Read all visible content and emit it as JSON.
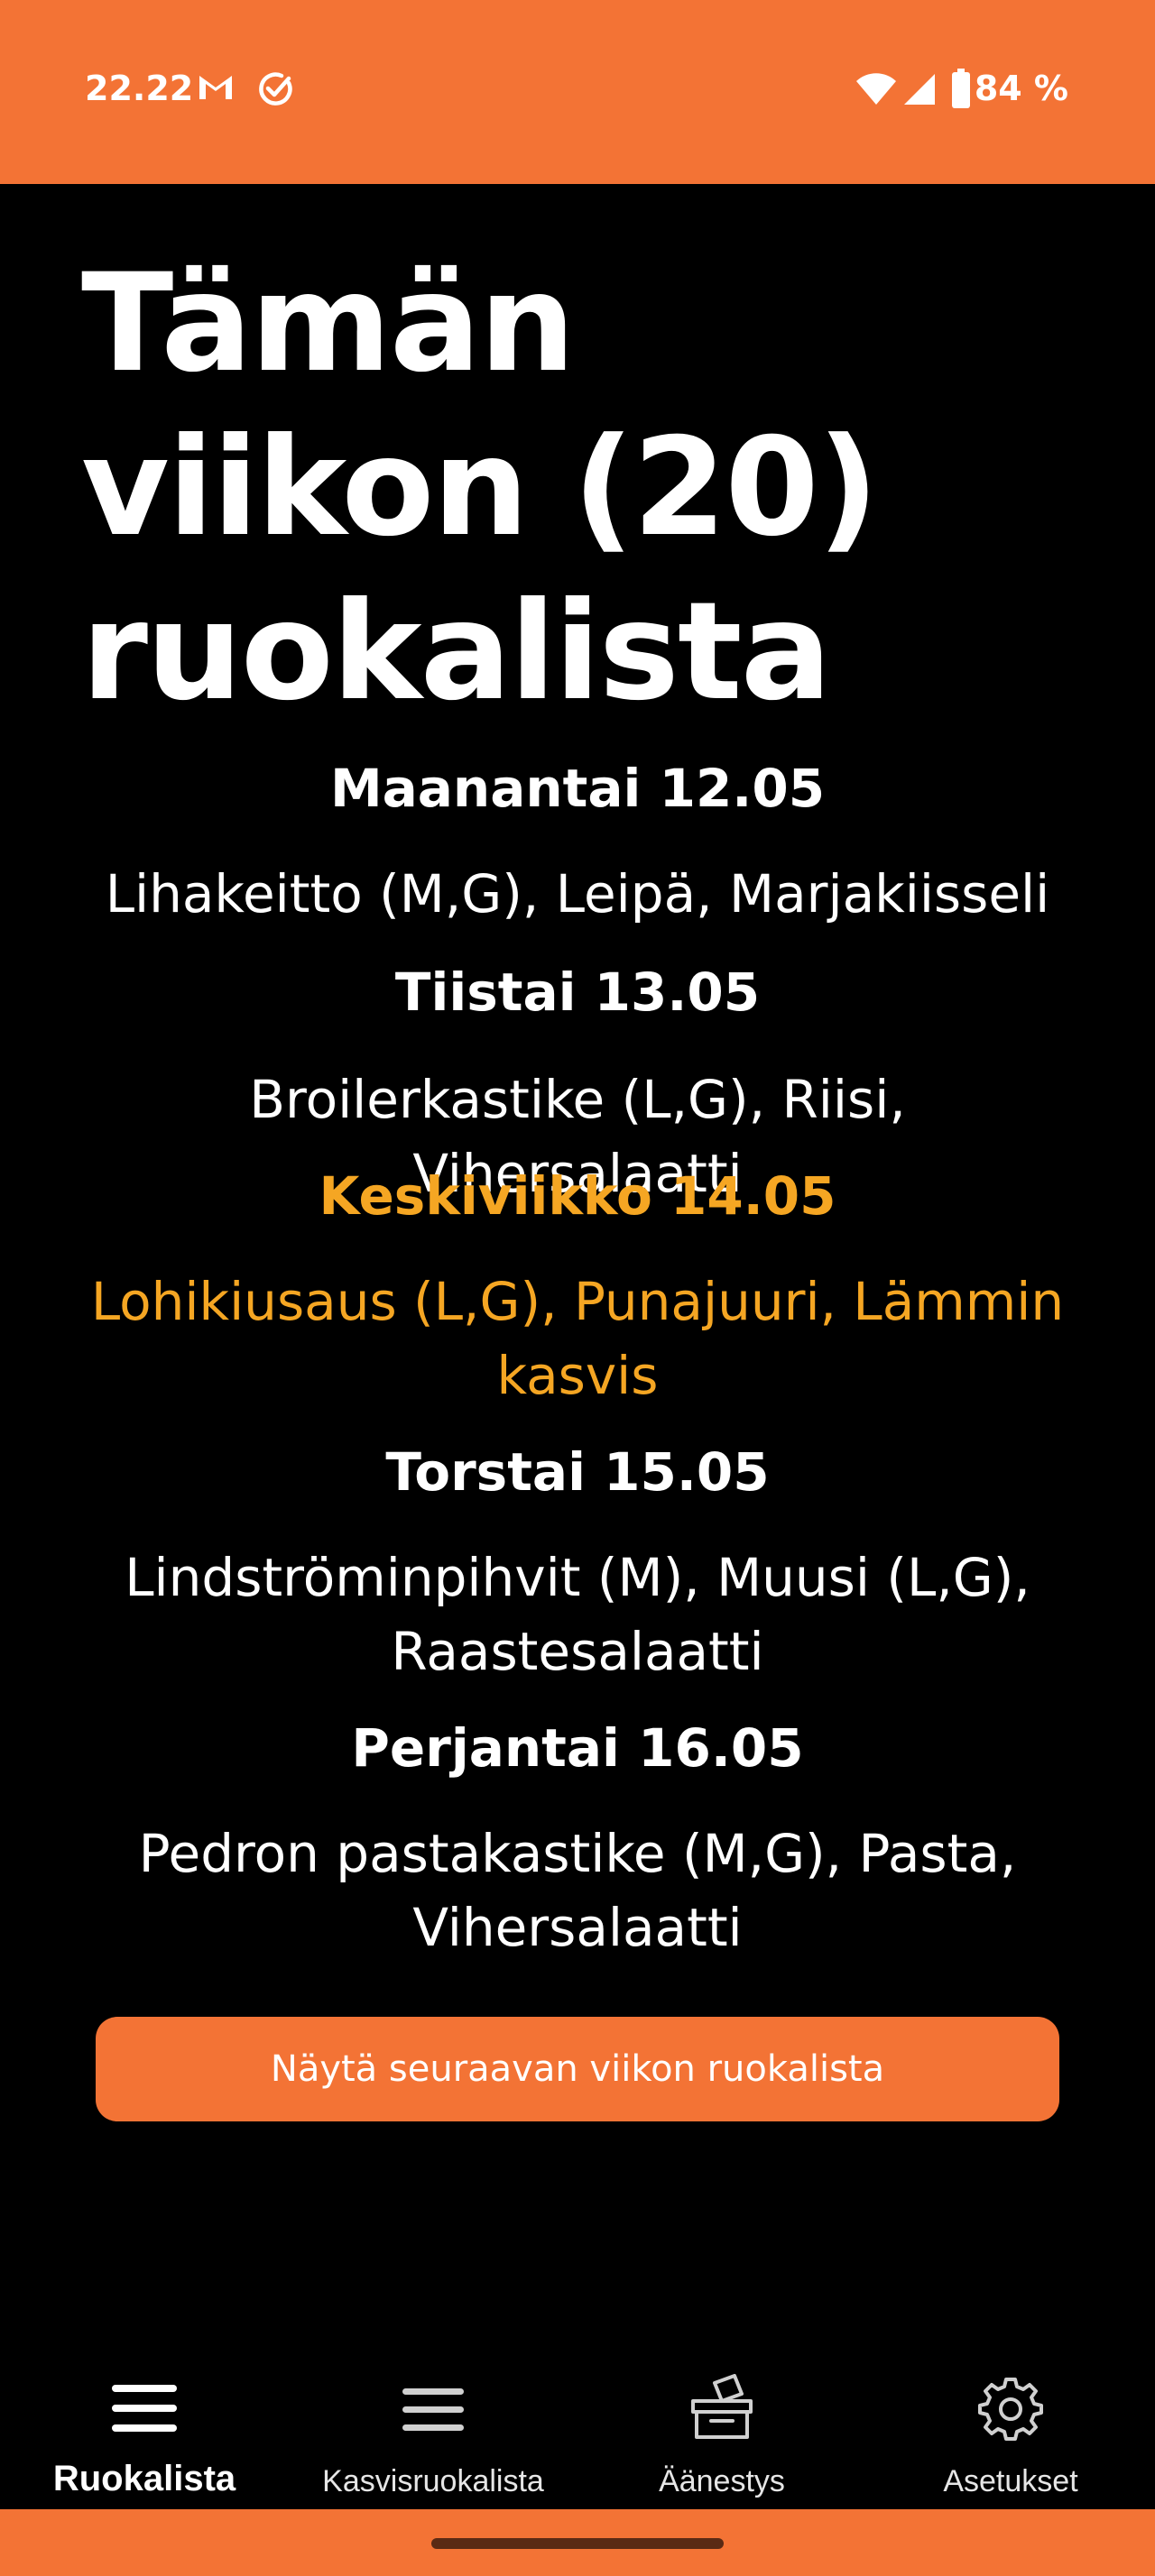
{
  "status_bar": {
    "time": "22.22",
    "battery": "84 %",
    "icons": [
      "gmail-icon",
      "check-circle-icon",
      "wifi-icon",
      "signal-icon",
      "battery-icon"
    ]
  },
  "page": {
    "title_line1": "Tämän",
    "title_line2": "viikon (20)",
    "title_line3": "ruokalista"
  },
  "menu": {
    "days": [
      {
        "title": "Maanantai 12.05",
        "food": "Lihakeitto (M,G), Leipä, Marjakiisseli",
        "today": false
      },
      {
        "title": "Tiistai 13.05",
        "food": "Broilerkastike (L,G), Riisi, Vihersalaatti",
        "today": false
      },
      {
        "title": "Keskiviikko 14.05",
        "food": "Lohikiusaus (L,G), Punajuuri, Lämmin kasvis",
        "today": true
      },
      {
        "title": "Torstai 15.05",
        "food": "Lindströminpihvit (M), Muusi (L,G), Raastesalaatti",
        "today": false
      },
      {
        "title": "Perjantai 16.05",
        "food": "Pedron pastakastike (M,G), Pasta, Vihersalaatti",
        "today": false
      }
    ]
  },
  "next_week_button": "Näytä seuraavan viikon ruokalista",
  "bottom_nav": {
    "items": [
      {
        "label": "Ruokalista",
        "icon": "menu-icon",
        "active": true
      },
      {
        "label": "Kasvisruokalista",
        "icon": "menu-icon",
        "active": false
      },
      {
        "label": "Äänestys",
        "icon": "ballot-box-icon",
        "active": false
      },
      {
        "label": "Asetukset",
        "icon": "gear-icon",
        "active": false
      }
    ]
  },
  "colors": {
    "accent": "#F37335",
    "today_highlight": "#F5A623",
    "background": "#000000"
  }
}
